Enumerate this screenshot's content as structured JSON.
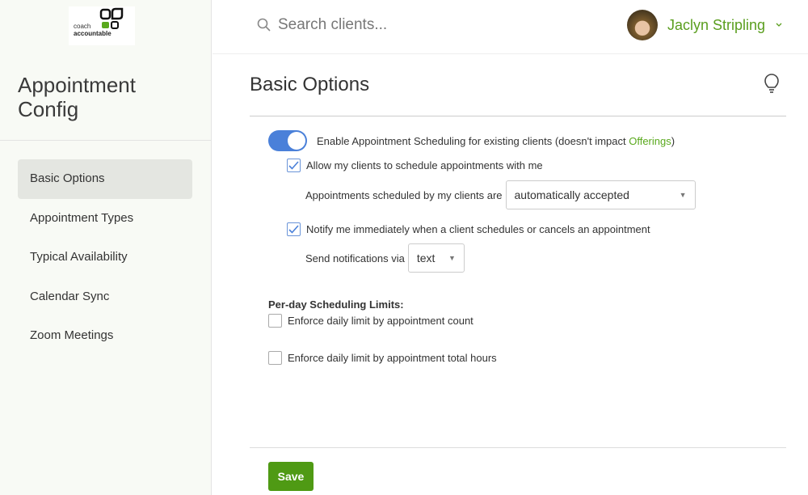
{
  "logo": {
    "text": "coach accountable"
  },
  "sidebar": {
    "title": "Appointment Config",
    "items": [
      {
        "label": "Basic Options",
        "active": true
      },
      {
        "label": "Appointment Types"
      },
      {
        "label": "Typical Availability"
      },
      {
        "label": "Calendar Sync"
      },
      {
        "label": "Zoom Meetings"
      }
    ]
  },
  "header": {
    "search_placeholder": "Search clients...",
    "user_name": "Jaclyn Stripling"
  },
  "main": {
    "title": "Basic Options",
    "enable_label_prefix": "Enable Appointment Scheduling for existing clients (doesn't impact ",
    "enable_link": "Offerings",
    "enable_label_suffix": ")",
    "enable_on": true,
    "allow_label": "Allow my clients to schedule appointments with me",
    "allow_checked": true,
    "scheduled_label": "Appointments scheduled by my clients are",
    "scheduled_value": "automatically accepted",
    "notify_label": "Notify me immediately when a client schedules or cancels an appointment",
    "notify_checked": true,
    "send_label": "Send notifications via",
    "send_value": "text",
    "limits_title": "Per-day Scheduling Limits:",
    "limit_count_label": "Enforce daily limit by appointment count",
    "limit_hours_label": "Enforce daily limit by appointment total hours",
    "save_label": "Save"
  },
  "colors": {
    "accent_green": "#5aa91d",
    "toggle_blue": "#4a80d9",
    "save_green": "#4f9a14"
  }
}
